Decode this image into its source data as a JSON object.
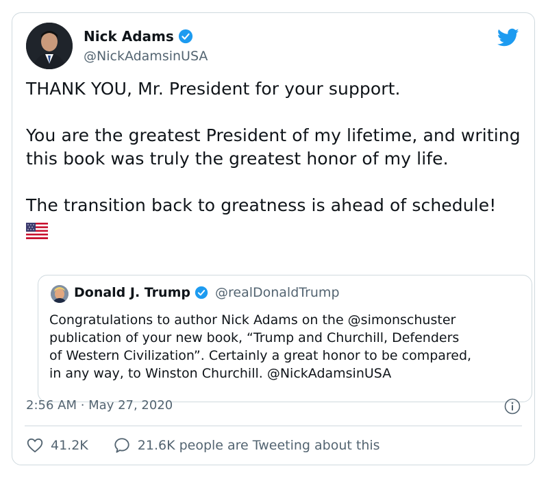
{
  "author": {
    "name": "Nick Adams",
    "handle": "@NickAdamsinUSA"
  },
  "tweet": {
    "line1": "THANK YOU, Mr. President for your support.",
    "line2": "You are the greatest President of my lifetime, and writing this book was truly the greatest honor of my life.",
    "line3": "The transition back to greatness is ahead of schedule!",
    "timestamp": "2:56 AM · May 27, 2020"
  },
  "quoted": {
    "name": "Donald J. Trump",
    "handle": "@realDonaldTrump",
    "text": "Congratulations to author Nick Adams on the @simonschuster\n publication of your new book, “Trump and Churchill, Defenders\nof Western Civilization”. Certainly a great honor to be compared,\nin any way, to Winston Churchill.  @NickAdamsinUSA"
  },
  "stats": {
    "likes": "41.2K",
    "tweeting": "21.6K people are Tweeting about this"
  },
  "colors": {
    "verified": "#1d9bf0",
    "bird": "#1d9bf0",
    "border": "#cfd9de",
    "secondary_text": "#536471"
  },
  "icons": {
    "verified": "verified-badge-icon",
    "bird": "twitter-bird-icon",
    "info": "info-icon",
    "like": "heart-icon",
    "reply": "speech-bubble-icon",
    "flag": "us-flag-emoji"
  }
}
